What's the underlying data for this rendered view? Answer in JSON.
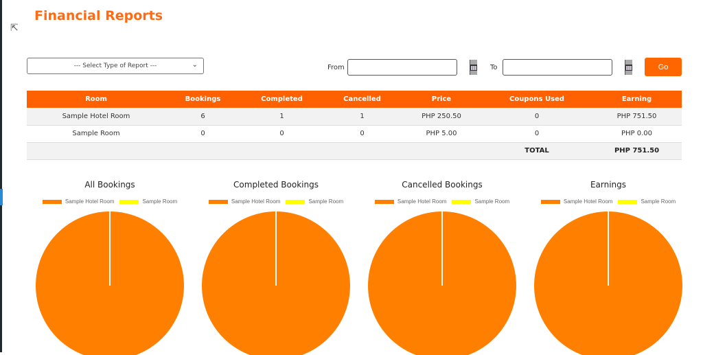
{
  "header": {
    "title": "Financial Reports"
  },
  "filters": {
    "report_type_placeholder": "--- Select Type of Report ---",
    "from_label": "From",
    "from_value": "",
    "to_label": "To",
    "to_value": "",
    "go_label": "Go"
  },
  "table": {
    "columns": [
      "Room",
      "Bookings",
      "Completed",
      "Cancelled",
      "Price",
      "Coupons Used",
      "Earning"
    ],
    "rows": [
      [
        "Sample Hotel Room",
        "6",
        "1",
        "1",
        "PHP 250.50",
        "0",
        "PHP 751.50"
      ],
      [
        "Sample Room",
        "0",
        "0",
        "0",
        "PHP 5.00",
        "0",
        "PHP 0.00"
      ]
    ],
    "total_label": "TOTAL",
    "total_value": "PHP 751.50"
  },
  "colors": {
    "accent": "#ff6600",
    "series1": "#ff8000",
    "series2": "#ffff00"
  },
  "chart_data": [
    {
      "type": "pie",
      "title": "All Bookings",
      "labels": [
        "Sample Hotel Room",
        "Sample Room"
      ],
      "values": [
        6,
        0
      ],
      "legend": "top"
    },
    {
      "type": "pie",
      "title": "Completed Bookings",
      "labels": [
        "Sample Hotel Room",
        "Sample Room"
      ],
      "values": [
        1,
        0
      ],
      "legend": "top"
    },
    {
      "type": "pie",
      "title": "Cancelled Bookings",
      "labels": [
        "Sample Hotel Room",
        "Sample Room"
      ],
      "values": [
        1,
        0
      ],
      "legend": "top"
    },
    {
      "type": "pie",
      "title": "Earnings",
      "labels": [
        "Sample Hotel Room",
        "Sample Room"
      ],
      "values": [
        751.5,
        0
      ],
      "legend": "top"
    }
  ]
}
